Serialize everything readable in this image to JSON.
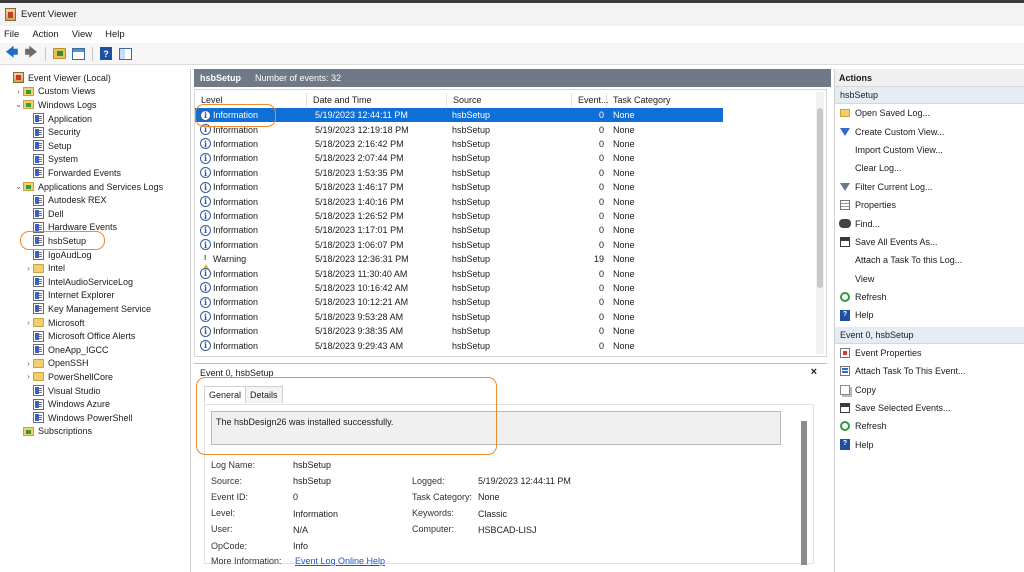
{
  "window": {
    "title": "Event Viewer"
  },
  "menu": [
    "File",
    "Action",
    "View",
    "Help"
  ],
  "toolbar": {
    "icons": [
      "back-arrow-icon",
      "forward-arrow-icon",
      "folder-up-icon",
      "console-grid-icon",
      "help-icon",
      "show-pane-icon"
    ]
  },
  "tree": [
    {
      "label": "Event Viewer (Local)",
      "level": 0,
      "icon": "root",
      "chev": ""
    },
    {
      "label": "Custom Views",
      "level": 1,
      "icon": "folder-open",
      "chev": "›"
    },
    {
      "label": "Windows Logs",
      "level": 1,
      "icon": "folder-open",
      "chev": "⌄"
    },
    {
      "label": "Application",
      "level": 2,
      "icon": "log",
      "chev": ""
    },
    {
      "label": "Security",
      "level": 2,
      "icon": "log",
      "chev": ""
    },
    {
      "label": "Setup",
      "level": 2,
      "icon": "log",
      "chev": ""
    },
    {
      "label": "System",
      "level": 2,
      "icon": "log",
      "chev": ""
    },
    {
      "label": "Forwarded Events",
      "level": 2,
      "icon": "log",
      "chev": ""
    },
    {
      "label": "Applications and Services Logs",
      "level": 1,
      "icon": "folder-open",
      "chev": "⌄"
    },
    {
      "label": "Autodesk REX",
      "level": 2,
      "icon": "log",
      "chev": ""
    },
    {
      "label": "Dell",
      "level": 2,
      "icon": "log",
      "chev": ""
    },
    {
      "label": "Hardware Events",
      "level": 2,
      "icon": "log",
      "chev": ""
    },
    {
      "label": "hsbSetup",
      "level": 2,
      "icon": "log",
      "chev": ""
    },
    {
      "label": "IgoAudLog",
      "level": 2,
      "icon": "log",
      "chev": ""
    },
    {
      "label": "Intel",
      "level": 2,
      "icon": "folder",
      "chev": "›"
    },
    {
      "label": "IntelAudioServiceLog",
      "level": 2,
      "icon": "log",
      "chev": ""
    },
    {
      "label": "Internet Explorer",
      "level": 2,
      "icon": "log",
      "chev": ""
    },
    {
      "label": "Key Management Service",
      "level": 2,
      "icon": "log",
      "chev": ""
    },
    {
      "label": "Microsoft",
      "level": 2,
      "icon": "folder",
      "chev": "›"
    },
    {
      "label": "Microsoft Office Alerts",
      "level": 2,
      "icon": "log",
      "chev": ""
    },
    {
      "label": "OneApp_IGCC",
      "level": 2,
      "icon": "log",
      "chev": ""
    },
    {
      "label": "OpenSSH",
      "level": 2,
      "icon": "folder",
      "chev": "›"
    },
    {
      "label": "PowerShellCore",
      "level": 2,
      "icon": "folder",
      "chev": "›"
    },
    {
      "label": "Visual Studio",
      "level": 2,
      "icon": "log",
      "chev": ""
    },
    {
      "label": "Windows Azure",
      "level": 2,
      "icon": "log",
      "chev": ""
    },
    {
      "label": "Windows PowerShell",
      "level": 2,
      "icon": "log",
      "chev": ""
    },
    {
      "label": "Subscriptions",
      "level": 1,
      "icon": "folder-open",
      "chev": ""
    }
  ],
  "events_pane": {
    "log_name": "hsbSetup",
    "count_text": "Number of events: 32",
    "columns": [
      "Level",
      "Date and Time",
      "Source",
      "Event...",
      "Task Category"
    ],
    "rows": [
      {
        "level": "Information",
        "date": "5/19/2023 12:44:11 PM",
        "source": "hsbSetup",
        "event": "0",
        "task": "None",
        "icon": "info",
        "selected": true
      },
      {
        "level": "Information",
        "date": "5/19/2023 12:19:18 PM",
        "source": "hsbSetup",
        "event": "0",
        "task": "None",
        "icon": "info"
      },
      {
        "level": "Information",
        "date": "5/18/2023 2:16:42 PM",
        "source": "hsbSetup",
        "event": "0",
        "task": "None",
        "icon": "info"
      },
      {
        "level": "Information",
        "date": "5/18/2023 2:07:44 PM",
        "source": "hsbSetup",
        "event": "0",
        "task": "None",
        "icon": "info"
      },
      {
        "level": "Information",
        "date": "5/18/2023 1:53:35 PM",
        "source": "hsbSetup",
        "event": "0",
        "task": "None",
        "icon": "info"
      },
      {
        "level": "Information",
        "date": "5/18/2023 1:46:17 PM",
        "source": "hsbSetup",
        "event": "0",
        "task": "None",
        "icon": "info"
      },
      {
        "level": "Information",
        "date": "5/18/2023 1:40:16 PM",
        "source": "hsbSetup",
        "event": "0",
        "task": "None",
        "icon": "info"
      },
      {
        "level": "Information",
        "date": "5/18/2023 1:26:52 PM",
        "source": "hsbSetup",
        "event": "0",
        "task": "None",
        "icon": "info"
      },
      {
        "level": "Information",
        "date": "5/18/2023 1:17:01 PM",
        "source": "hsbSetup",
        "event": "0",
        "task": "None",
        "icon": "info"
      },
      {
        "level": "Information",
        "date": "5/18/2023 1:06:07 PM",
        "source": "hsbSetup",
        "event": "0",
        "task": "None",
        "icon": "info"
      },
      {
        "level": "Warning",
        "date": "5/18/2023 12:36:31 PM",
        "source": "hsbSetup",
        "event": "19",
        "task": "None",
        "icon": "warning"
      },
      {
        "level": "Information",
        "date": "5/18/2023 11:30:40 AM",
        "source": "hsbSetup",
        "event": "0",
        "task": "None",
        "icon": "info"
      },
      {
        "level": "Information",
        "date": "5/18/2023 10:16:42 AM",
        "source": "hsbSetup",
        "event": "0",
        "task": "None",
        "icon": "info"
      },
      {
        "level": "Information",
        "date": "5/18/2023 10:12:21 AM",
        "source": "hsbSetup",
        "event": "0",
        "task": "None",
        "icon": "info"
      },
      {
        "level": "Information",
        "date": "5/18/2023 9:53:28 AM",
        "source": "hsbSetup",
        "event": "0",
        "task": "None",
        "icon": "info"
      },
      {
        "level": "Information",
        "date": "5/18/2023 9:38:35 AM",
        "source": "hsbSetup",
        "event": "0",
        "task": "None",
        "icon": "info"
      },
      {
        "level": "Information",
        "date": "5/18/2023 9:29:43 AM",
        "source": "hsbSetup",
        "event": "0",
        "task": "None",
        "icon": "info"
      }
    ]
  },
  "detail": {
    "title": "Event 0, hsbSetup",
    "close": "×",
    "tabs": [
      "General",
      "Details"
    ],
    "description": "The hsbDesign26 was installed successfully.",
    "fields": {
      "log_name_label": "Log Name:",
      "log_name": "hsbSetup",
      "source_label": "Source:",
      "source": "hsbSetup",
      "logged_label": "Logged:",
      "logged": "5/19/2023 12:44:11 PM",
      "event_id_label": "Event ID:",
      "event_id": "0",
      "task_label": "Task Category:",
      "task": "None",
      "level_label": "Level:",
      "level": "Information",
      "keywords_label": "Keywords:",
      "keywords": "Classic",
      "user_label": "User:",
      "user": "N/A",
      "computer_label": "Computer:",
      "computer": "HSBCAD-LISJ",
      "opcode_label": "OpCode:",
      "opcode": "Info",
      "more_label": "More Information:",
      "more_link": "Event Log Online Help"
    }
  },
  "actions": {
    "title": "Actions",
    "section1": "hsbSetup",
    "items1": [
      {
        "label": "Open Saved Log...",
        "icon": "open"
      },
      {
        "label": "Create Custom View...",
        "icon": "filter"
      },
      {
        "label": "Import Custom View...",
        "icon": ""
      },
      {
        "label": "Clear Log...",
        "icon": ""
      },
      {
        "label": "Filter Current Log...",
        "icon": "filter2"
      },
      {
        "label": "Properties",
        "icon": "props"
      },
      {
        "label": "Find...",
        "icon": "find"
      },
      {
        "label": "Save All Events As...",
        "icon": "save"
      },
      {
        "label": "Attach a Task To this Log...",
        "icon": ""
      },
      {
        "label": "View",
        "icon": ""
      },
      {
        "label": "Refresh",
        "icon": "refresh"
      },
      {
        "label": "Help",
        "icon": "help"
      }
    ],
    "section2": "Event 0, hsbSetup",
    "items2": [
      {
        "label": "Event Properties",
        "icon": "evprops"
      },
      {
        "label": "Attach Task To This Event...",
        "icon": "attach"
      },
      {
        "label": "Copy",
        "icon": "copy"
      },
      {
        "label": "Save Selected Events...",
        "icon": "save"
      },
      {
        "label": "Refresh",
        "icon": "refresh"
      },
      {
        "label": "Help",
        "icon": "help"
      }
    ]
  },
  "colors": {
    "selection": "#0f6fd6",
    "header_bar": "#6f7a86",
    "highlight_circle": "#ef8a2e",
    "link": "#1a56c8"
  }
}
